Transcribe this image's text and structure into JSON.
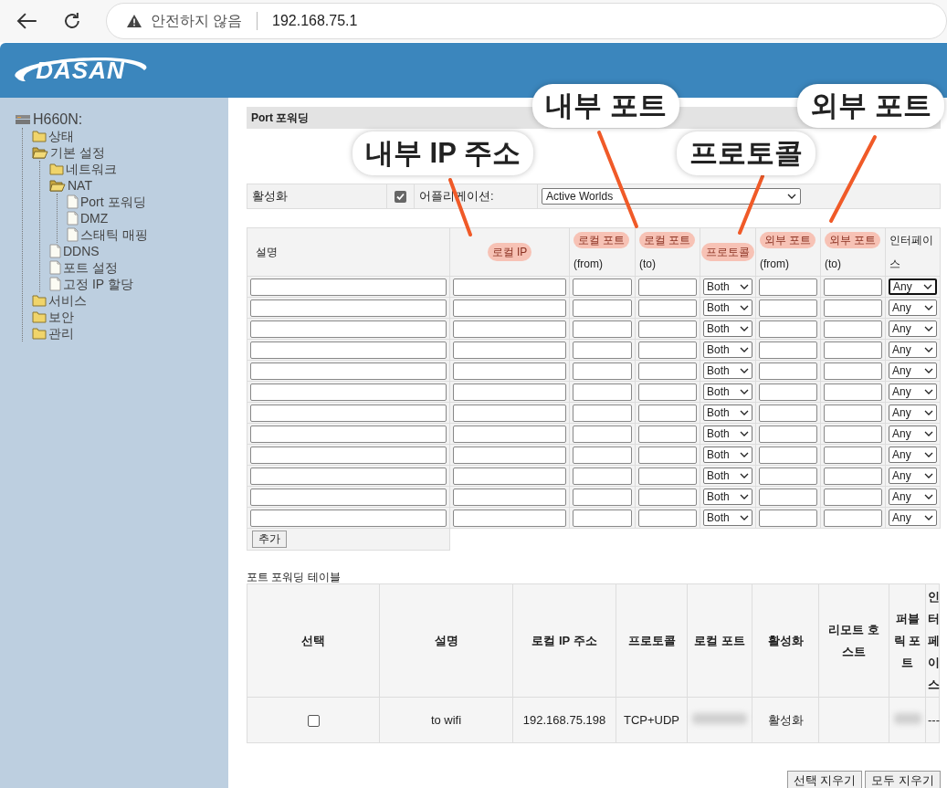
{
  "browser": {
    "security_label": "안전하지 않음",
    "url": "192.168.75.1"
  },
  "logo": "DASAN",
  "sidebar": {
    "tree": [
      {
        "label": "H660N:",
        "kind": "device",
        "children": [
          {
            "label": "상태",
            "kind": "folder",
            "expanded": false
          },
          {
            "label": "기본 설정",
            "kind": "folder",
            "expanded": true,
            "children": [
              {
                "label": "네트워크",
                "kind": "folder",
                "expanded": false
              },
              {
                "label": "NAT",
                "kind": "folder",
                "expanded": true,
                "children": [
                  {
                    "label": "Port 포워딩",
                    "kind": "page"
                  },
                  {
                    "label": "DMZ",
                    "kind": "page"
                  },
                  {
                    "label": "스태틱 매핑",
                    "kind": "page"
                  }
                ]
              },
              {
                "label": "DDNS",
                "kind": "page"
              },
              {
                "label": "포트 설정",
                "kind": "page"
              },
              {
                "label": "고정 IP 할당",
                "kind": "page"
              }
            ]
          },
          {
            "label": "서비스",
            "kind": "folder",
            "expanded": false
          },
          {
            "label": "보안",
            "kind": "folder",
            "expanded": false
          },
          {
            "label": "관리",
            "kind": "folder",
            "expanded": false
          }
        ]
      }
    ]
  },
  "section_title": "Port 포워딩",
  "enable": {
    "label": "활성화",
    "checked": true
  },
  "application": {
    "label": "어플리케이션:",
    "value": "Active Worlds"
  },
  "form": {
    "columns": [
      {
        "label": "설명",
        "highlighted": false
      },
      {
        "label": "로컬 IP",
        "highlighted": true
      },
      {
        "label": "로컬 포트",
        "sub": "(from)",
        "highlighted": true
      },
      {
        "label": "로컬 포트",
        "sub": "(to)",
        "highlighted": true
      },
      {
        "label": "프로토콜",
        "highlighted": true
      },
      {
        "label": "외부 포트",
        "sub": "(from)",
        "highlighted": true
      },
      {
        "label": "외부 포트",
        "sub": "(to)",
        "highlighted": true
      },
      {
        "label": "인터페이스",
        "highlighted": false
      }
    ],
    "rows": [
      {
        "protocol": "Both",
        "interface": "Any",
        "focused": true
      },
      {
        "protocol": "Both",
        "interface": "Any",
        "focused": false
      },
      {
        "protocol": "Both",
        "interface": "Any",
        "focused": false
      },
      {
        "protocol": "Both",
        "interface": "Any",
        "focused": false
      },
      {
        "protocol": "Both",
        "interface": "Any",
        "focused": false
      },
      {
        "protocol": "Both",
        "interface": "Any",
        "focused": false
      },
      {
        "protocol": "Both",
        "interface": "Any",
        "focused": false
      },
      {
        "protocol": "Both",
        "interface": "Any",
        "focused": false
      },
      {
        "protocol": "Both",
        "interface": "Any",
        "focused": false
      },
      {
        "protocol": "Both",
        "interface": "Any",
        "focused": false
      },
      {
        "protocol": "Both",
        "interface": "Any",
        "focused": false
      },
      {
        "protocol": "Both",
        "interface": "Any",
        "focused": false
      }
    ],
    "add_button": "추가"
  },
  "annotations": [
    {
      "text": "내부 IP 주소"
    },
    {
      "text": "내부 포트"
    },
    {
      "text": "프로토콜"
    },
    {
      "text": "외부 포트"
    }
  ],
  "table": {
    "title": "포트 포워딩 테이블",
    "columns": [
      "선택",
      "설명",
      "로컬 IP 주소",
      "프로토콜",
      "로컬 포트",
      "활성화",
      "리모트 호스트",
      "퍼블릭 포트",
      "인터페이스"
    ],
    "rows": [
      {
        "cells": [
          {
            "kind": "checkbox",
            "checked": false
          },
          {
            "kind": "text",
            "text": "to wifi"
          },
          {
            "kind": "text",
            "text": "192.168.75.198"
          },
          {
            "kind": "text",
            "text": "TCP+UDP"
          },
          {
            "kind": "redacted"
          },
          {
            "kind": "text",
            "text": "활성화"
          },
          {
            "kind": "empty"
          },
          {
            "kind": "redacted"
          },
          {
            "kind": "text",
            "text": "---"
          }
        ]
      }
    ]
  },
  "buttons": [
    "선택 지우기",
    "모두 지우기"
  ]
}
